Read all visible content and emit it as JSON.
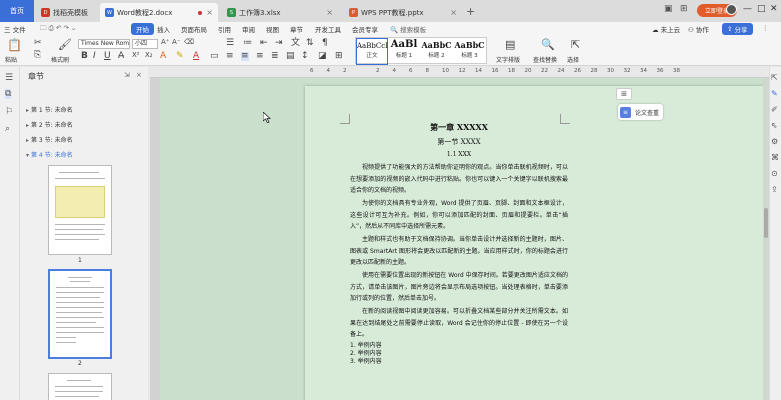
{
  "titlebar": {
    "home_tab": "首页",
    "tabs": [
      {
        "label": "找稻壳模板",
        "icon_text": "D",
        "icon_color": "#d0352b"
      },
      {
        "label": "Word教程2.docx",
        "icon_text": "W",
        "icon_color": "#3a6fd8"
      },
      {
        "label": "工作簿3.xlsx",
        "icon_text": "S",
        "icon_color": "#2c9a4c"
      },
      {
        "label": "WPS PPT教程.pptx",
        "icon_text": "P",
        "icon_color": "#e25c2b"
      }
    ],
    "new_tab": "+",
    "login_label": "立即登录",
    "win_minimize": "—",
    "win_restore": "□",
    "win_close": "✕"
  },
  "menubar": {
    "file": "三 文件",
    "items": [
      "开始",
      "插入",
      "页面布局",
      "引用",
      "审阅",
      "视图",
      "章节",
      "开发工具",
      "会员专享"
    ],
    "active_index": 0,
    "search": "🔍 搜索模板",
    "sync": "未上云",
    "collab": "协作",
    "share": "分享"
  },
  "ribbon": {
    "paste": "粘贴",
    "format_painter": "格式刷",
    "font_name": "Times New Roma",
    "font_size": "小四",
    "styles": [
      {
        "sample": "AaBbCcI",
        "name": "正文"
      },
      {
        "sample": "AaBl",
        "name": "标题 1"
      },
      {
        "sample": "AaBbC",
        "name": "标题 2"
      },
      {
        "sample": "AaBbC",
        "name": "标题 3"
      }
    ],
    "text_layout": "文字排版",
    "find_replace": "查找替换",
    "select": "选择"
  },
  "nav": {
    "title": "章节",
    "chapters": [
      "第 1 节: 未命名",
      "第 2 节: 未命名",
      "第 3 节: 未命名",
      "第 4 节: 未命名"
    ],
    "active_chapter": 3,
    "page_numbers": [
      "1",
      "2"
    ]
  },
  "ruler": {
    "ticks": [
      "6",
      "4",
      "2",
      "",
      "2",
      "4",
      "6",
      "8",
      "10",
      "12",
      "14",
      "16",
      "18",
      "20",
      "22",
      "24",
      "26",
      "28",
      "30",
      "32",
      "34",
      "36",
      "38"
    ]
  },
  "document": {
    "chapter_title": "第一章 XXXXX",
    "section_title": "第一节 XXXX",
    "subsection": "1.1 XXX",
    "paragraphs": [
      "视频提供了功能强大的方法帮助你证明你的观点。当你单击联机视频时，可以在想要添加的视频的嵌入代码中进行粘贴。你也可以键入一个关键字以联机搜索最适合你的文档的视频。",
      "为使你的文档具有专业外观，Word 提供了页眉、页脚、封面和文本框设计，这些设计可互为补充。例如，你可以添加匹配的封面、页眉和提要栏。单击“插入”，然后从不同库中选择所需元素。",
      "主题和样式也有助于文档保持协调。当你单击设计并选择新的主题时，图片、图表或 SmartArt 图形将会更改以匹配新的主题。当应用样式时，你的标题会进行更改以匹配新的主题。",
      "使用在需要位置出现的新按钮在 Word 中保存时间。若要更改图片适应文档的方式，请单击该图片，图片旁边将会显示布局选项按钮。当处理表格时，单击要添加行或列的位置，然后单击加号。",
      "在新的阅读视图中阅读更加容易。可以折叠文档某些部分并关注所需文本。如果在达到结尾处之前需要停止读取，Word 会记住你的停止位置 - 即使在另一个设备上。"
    ],
    "list": [
      "1. 举例内容",
      "2. 举例内容",
      "3. 举例内容"
    ]
  },
  "float_tools": {
    "essay_check": "论文查重"
  }
}
